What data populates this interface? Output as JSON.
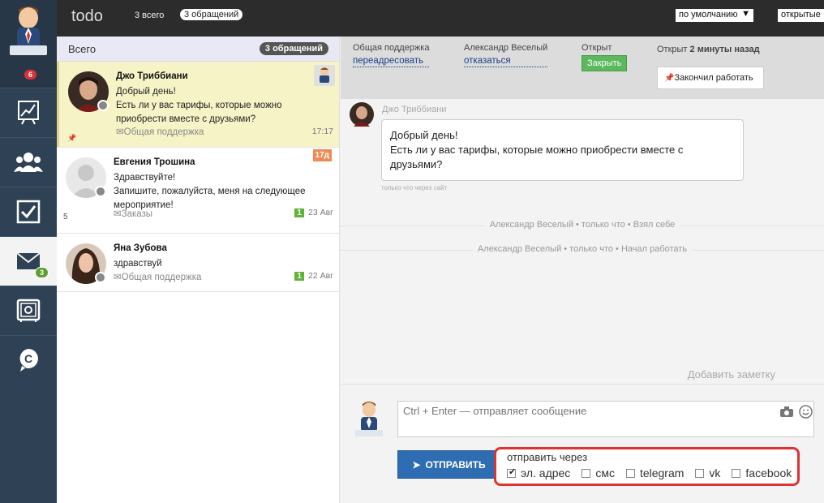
{
  "topbar": {
    "logo": "todo",
    "total_label": "3 всего",
    "requests_pill": "3 обращений",
    "sort_value": "по умолчанию",
    "filter_value": "открытые"
  },
  "rail": {
    "notify_count": "6",
    "mail_count": "3",
    "items": [
      "chart-icon",
      "users-icon",
      "checkbox-icon",
      "mail-icon",
      "safe-icon",
      "support-icon"
    ]
  },
  "list": {
    "title": "Всего",
    "count_pill": "3 обращений",
    "conversations": [
      {
        "name": "Джо Триббиани",
        "message": "Добрый день!\nЕсть ли у вас тарифы, которые можно приобрести вместе с друзьями?",
        "category": "Общая поддержка",
        "time": "17:17"
      },
      {
        "name": "Евгения Трошина",
        "message": "Здравствуйте!\nЗапишите, пожалуйста, меня на следующее мероприятие!",
        "category": "Заказы",
        "badge": "17д",
        "day_count": "1",
        "time": "23 Авг",
        "side_number": "5"
      },
      {
        "name": "Яна Зубова",
        "message": "здравствуй",
        "category": "Общая поддержка",
        "day_count": "1",
        "time": "22 Авг"
      }
    ]
  },
  "chat": {
    "header": {
      "department": "Общая поддержка",
      "redirect": "переадресовать",
      "agent": "Александр Веселый",
      "refuse": "отказаться",
      "status": "Открыт",
      "close_btn": "Закрыть",
      "opened_prefix": "Открыт",
      "opened_ago": "2 минуты назад",
      "finished_btn": "Закончил работать"
    },
    "message": {
      "author": "Джо Триббиани",
      "text_line1": "Добрый день!",
      "text_line2": "Есть ли у вас тарифы, которые можно приобрести вместе с друзьями?",
      "via": "только что через сайт"
    },
    "events": [
      "Александр Веселый • только что • Взял себе",
      "Александр Веселый • только что • Начал работать"
    ],
    "add_note": "Добавить заметку",
    "composer": {
      "placeholder": "Ctrl + Enter — отправляет сообщение",
      "send_btn": "ОТПРАВИТЬ",
      "send_via_title": "отправить через",
      "channels": [
        {
          "label": "эл. адрес",
          "checked": true
        },
        {
          "label": "смс",
          "checked": false
        },
        {
          "label": "telegram",
          "checked": false
        },
        {
          "label": "vk",
          "checked": false
        },
        {
          "label": "facebook",
          "checked": false
        }
      ]
    }
  }
}
